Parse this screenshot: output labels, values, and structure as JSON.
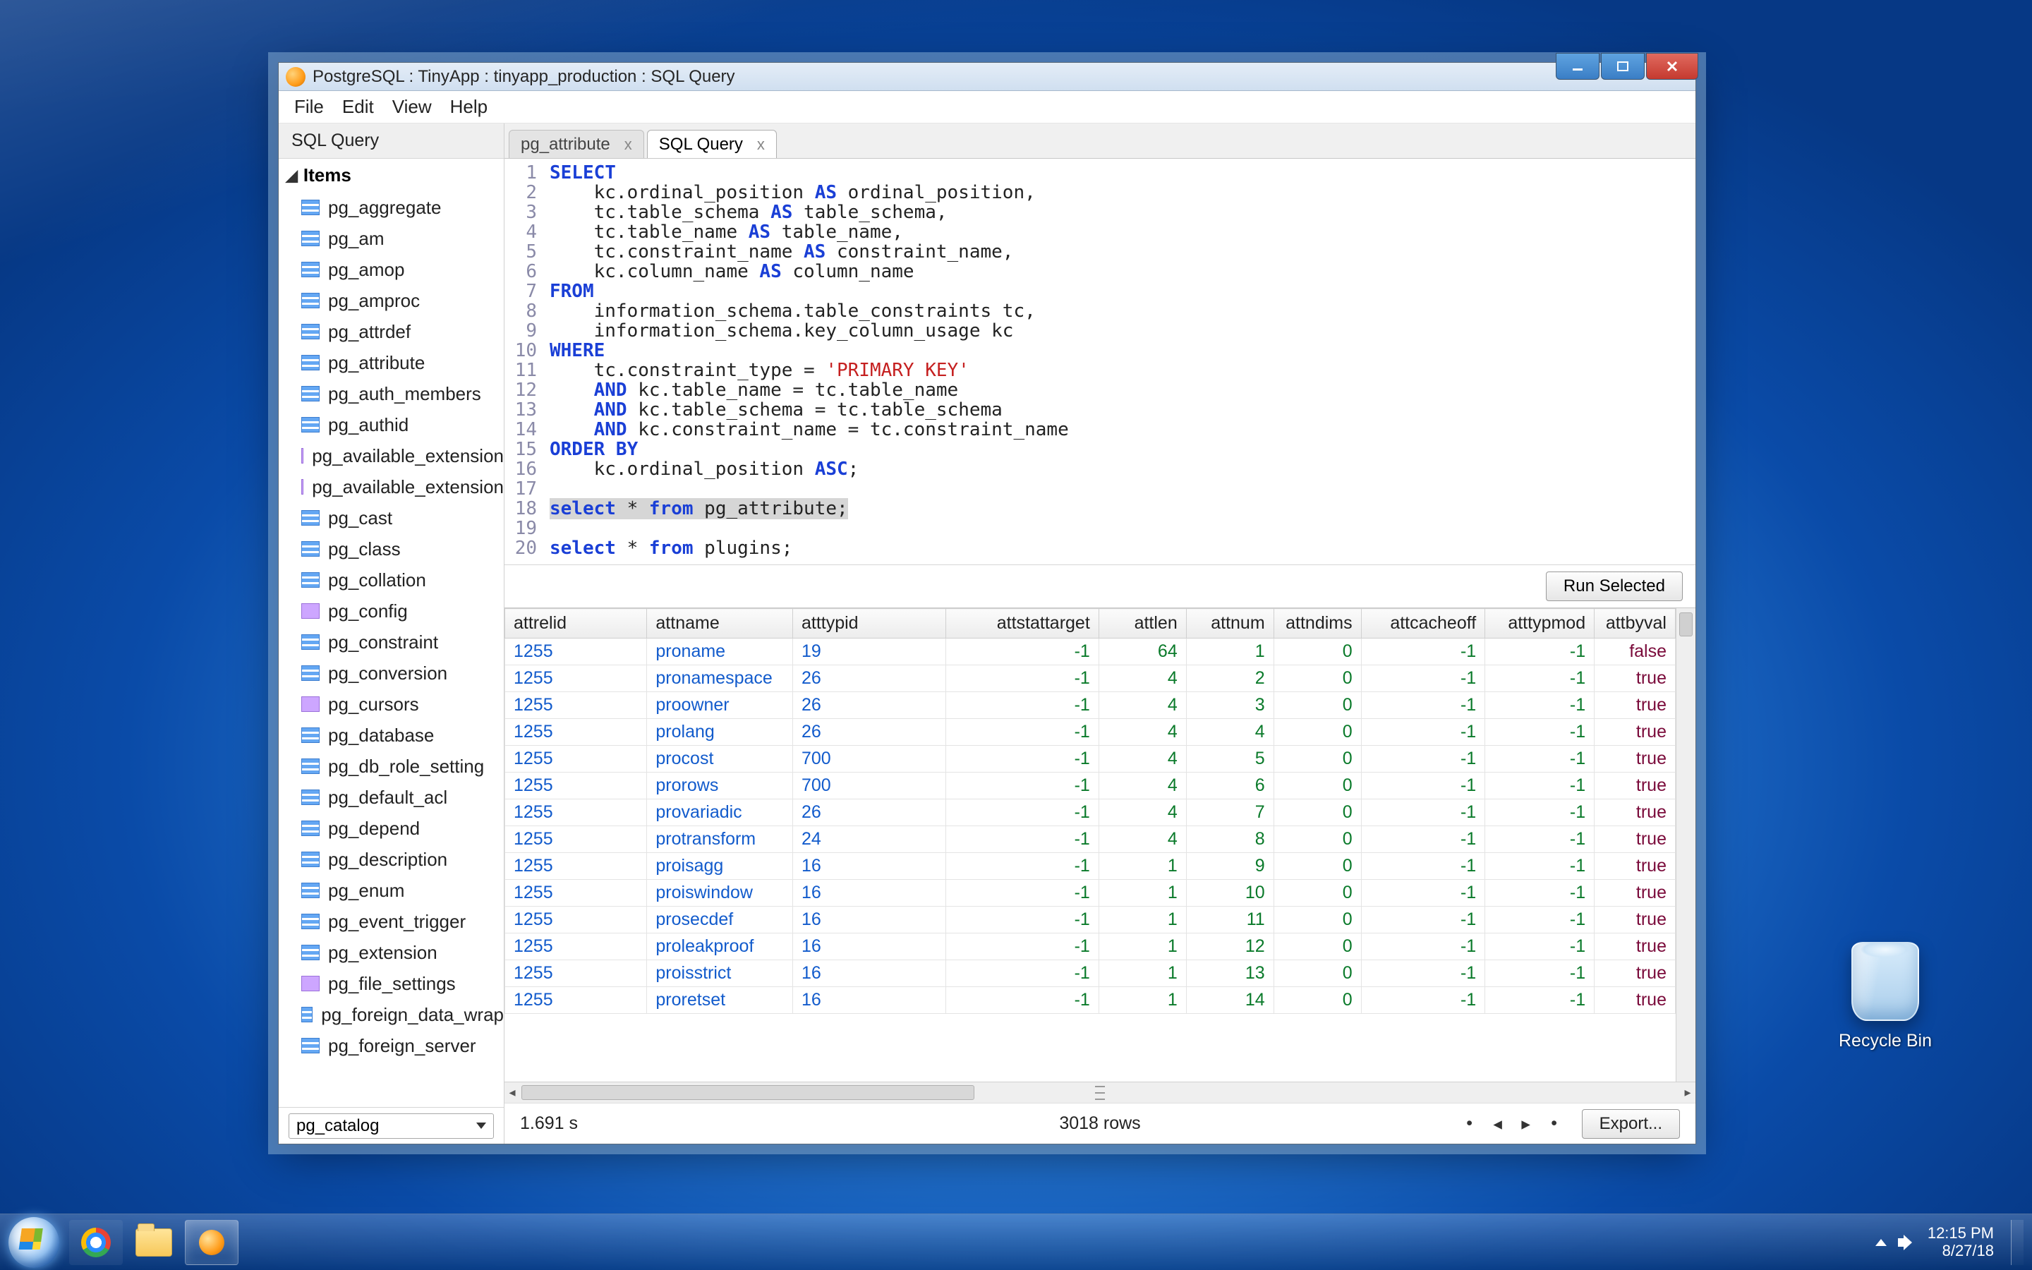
{
  "desktop": {
    "recycle_label": "Recycle Bin"
  },
  "taskbar": {
    "time": "12:15 PM",
    "date": "8/27/18"
  },
  "window": {
    "title": "PostgreSQL : TinyApp : tinyapp_production : SQL Query",
    "menu": [
      "File",
      "Edit",
      "View",
      "Help"
    ]
  },
  "sidebar": {
    "header": "SQL Query",
    "group": "Items",
    "items": [
      {
        "t": "table",
        "l": "pg_aggregate"
      },
      {
        "t": "table",
        "l": "pg_am"
      },
      {
        "t": "table",
        "l": "pg_amop"
      },
      {
        "t": "table",
        "l": "pg_amproc"
      },
      {
        "t": "table",
        "l": "pg_attrdef"
      },
      {
        "t": "table",
        "l": "pg_attribute"
      },
      {
        "t": "table",
        "l": "pg_auth_members"
      },
      {
        "t": "table",
        "l": "pg_authid"
      },
      {
        "t": "view",
        "l": "pg_available_extension"
      },
      {
        "t": "view",
        "l": "pg_available_extension"
      },
      {
        "t": "table",
        "l": "pg_cast"
      },
      {
        "t": "table",
        "l": "pg_class"
      },
      {
        "t": "table",
        "l": "pg_collation"
      },
      {
        "t": "view",
        "l": "pg_config"
      },
      {
        "t": "table",
        "l": "pg_constraint"
      },
      {
        "t": "table",
        "l": "pg_conversion"
      },
      {
        "t": "view",
        "l": "pg_cursors"
      },
      {
        "t": "table",
        "l": "pg_database"
      },
      {
        "t": "table",
        "l": "pg_db_role_setting"
      },
      {
        "t": "table",
        "l": "pg_default_acl"
      },
      {
        "t": "table",
        "l": "pg_depend"
      },
      {
        "t": "table",
        "l": "pg_description"
      },
      {
        "t": "table",
        "l": "pg_enum"
      },
      {
        "t": "table",
        "l": "pg_event_trigger"
      },
      {
        "t": "table",
        "l": "pg_extension"
      },
      {
        "t": "view",
        "l": "pg_file_settings"
      },
      {
        "t": "table",
        "l": "pg_foreign_data_wrap"
      },
      {
        "t": "table",
        "l": "pg_foreign_server"
      }
    ],
    "combo": "pg_catalog"
  },
  "tabs": {
    "inactive": "pg_attribute",
    "active": "SQL Query"
  },
  "editor": {
    "line_count": 20,
    "lines": [
      [
        {
          "k": "kw",
          "v": "SELECT"
        }
      ],
      [
        {
          "v": "    kc.ordinal_position "
        },
        {
          "k": "kw",
          "v": "AS"
        },
        {
          "v": " ordinal_position,"
        }
      ],
      [
        {
          "v": "    tc.table_schema "
        },
        {
          "k": "kw",
          "v": "AS"
        },
        {
          "v": " table_schema,"
        }
      ],
      [
        {
          "v": "    tc.table_name "
        },
        {
          "k": "kw",
          "v": "AS"
        },
        {
          "v": " table_name,"
        }
      ],
      [
        {
          "v": "    tc.constraint_name "
        },
        {
          "k": "kw",
          "v": "AS"
        },
        {
          "v": " constraint_name,"
        }
      ],
      [
        {
          "v": "    kc.column_name "
        },
        {
          "k": "kw",
          "v": "AS"
        },
        {
          "v": " column_name"
        }
      ],
      [
        {
          "k": "kw",
          "v": "FROM"
        }
      ],
      [
        {
          "v": "    information_schema.table_constraints tc,"
        }
      ],
      [
        {
          "v": "    information_schema.key_column_usage kc"
        }
      ],
      [
        {
          "k": "kw",
          "v": "WHERE"
        }
      ],
      [
        {
          "v": "    tc.constraint_type = "
        },
        {
          "k": "str",
          "v": "'PRIMARY KEY'"
        }
      ],
      [
        {
          "v": "    "
        },
        {
          "k": "kw",
          "v": "AND"
        },
        {
          "v": " kc.table_name = tc.table_name"
        }
      ],
      [
        {
          "v": "    "
        },
        {
          "k": "kw",
          "v": "AND"
        },
        {
          "v": " kc.table_schema = tc.table_schema"
        }
      ],
      [
        {
          "v": "    "
        },
        {
          "k": "kw",
          "v": "AND"
        },
        {
          "v": " kc.constraint_name = tc.constraint_name"
        }
      ],
      [
        {
          "k": "kw",
          "v": "ORDER BY"
        }
      ],
      [
        {
          "v": "    kc.ordinal_position "
        },
        {
          "k": "kw",
          "v": "ASC"
        },
        {
          "v": ";"
        }
      ],
      [
        {
          "v": ""
        }
      ],
      [
        {
          "k": "kw hl",
          "v": "select"
        },
        {
          "k": "hl",
          "v": " * "
        },
        {
          "k": "kw hl",
          "v": "from"
        },
        {
          "k": "hl",
          "v": " pg_attribute;"
        }
      ],
      [
        {
          "v": ""
        }
      ],
      [
        {
          "k": "kw",
          "v": "select"
        },
        {
          "v": " * "
        },
        {
          "k": "kw",
          "v": "from"
        },
        {
          "v": " plugins;"
        }
      ]
    ]
  },
  "run_button": "Run Selected",
  "table": {
    "columns": [
      "attrelid",
      "attname",
      "atttypid",
      "attstattarget",
      "attlen",
      "attnum",
      "attndims",
      "attcacheoff",
      "atttypmod",
      "attbyval"
    ],
    "rows": [
      [
        "1255",
        "proname",
        "19",
        "-1",
        "64",
        "1",
        "0",
        "-1",
        "-1",
        "false"
      ],
      [
        "1255",
        "pronamespace",
        "26",
        "-1",
        "4",
        "2",
        "0",
        "-1",
        "-1",
        "true"
      ],
      [
        "1255",
        "proowner",
        "26",
        "-1",
        "4",
        "3",
        "0",
        "-1",
        "-1",
        "true"
      ],
      [
        "1255",
        "prolang",
        "26",
        "-1",
        "4",
        "4",
        "0",
        "-1",
        "-1",
        "true"
      ],
      [
        "1255",
        "procost",
        "700",
        "-1",
        "4",
        "5",
        "0",
        "-1",
        "-1",
        "true"
      ],
      [
        "1255",
        "prorows",
        "700",
        "-1",
        "4",
        "6",
        "0",
        "-1",
        "-1",
        "true"
      ],
      [
        "1255",
        "provariadic",
        "26",
        "-1",
        "4",
        "7",
        "0",
        "-1",
        "-1",
        "true"
      ],
      [
        "1255",
        "protransform",
        "24",
        "-1",
        "4",
        "8",
        "0",
        "-1",
        "-1",
        "true"
      ],
      [
        "1255",
        "proisagg",
        "16",
        "-1",
        "1",
        "9",
        "0",
        "-1",
        "-1",
        "true"
      ],
      [
        "1255",
        "proiswindow",
        "16",
        "-1",
        "1",
        "10",
        "0",
        "-1",
        "-1",
        "true"
      ],
      [
        "1255",
        "prosecdef",
        "16",
        "-1",
        "1",
        "11",
        "0",
        "-1",
        "-1",
        "true"
      ],
      [
        "1255",
        "proleakproof",
        "16",
        "-1",
        "1",
        "12",
        "0",
        "-1",
        "-1",
        "true"
      ],
      [
        "1255",
        "proisstrict",
        "16",
        "-1",
        "1",
        "13",
        "0",
        "-1",
        "-1",
        "true"
      ],
      [
        "1255",
        "proretset",
        "16",
        "-1",
        "1",
        "14",
        "0",
        "-1",
        "-1",
        "true"
      ]
    ]
  },
  "status": {
    "time": "1.691 s",
    "rows": "3018 rows",
    "export": "Export..."
  }
}
